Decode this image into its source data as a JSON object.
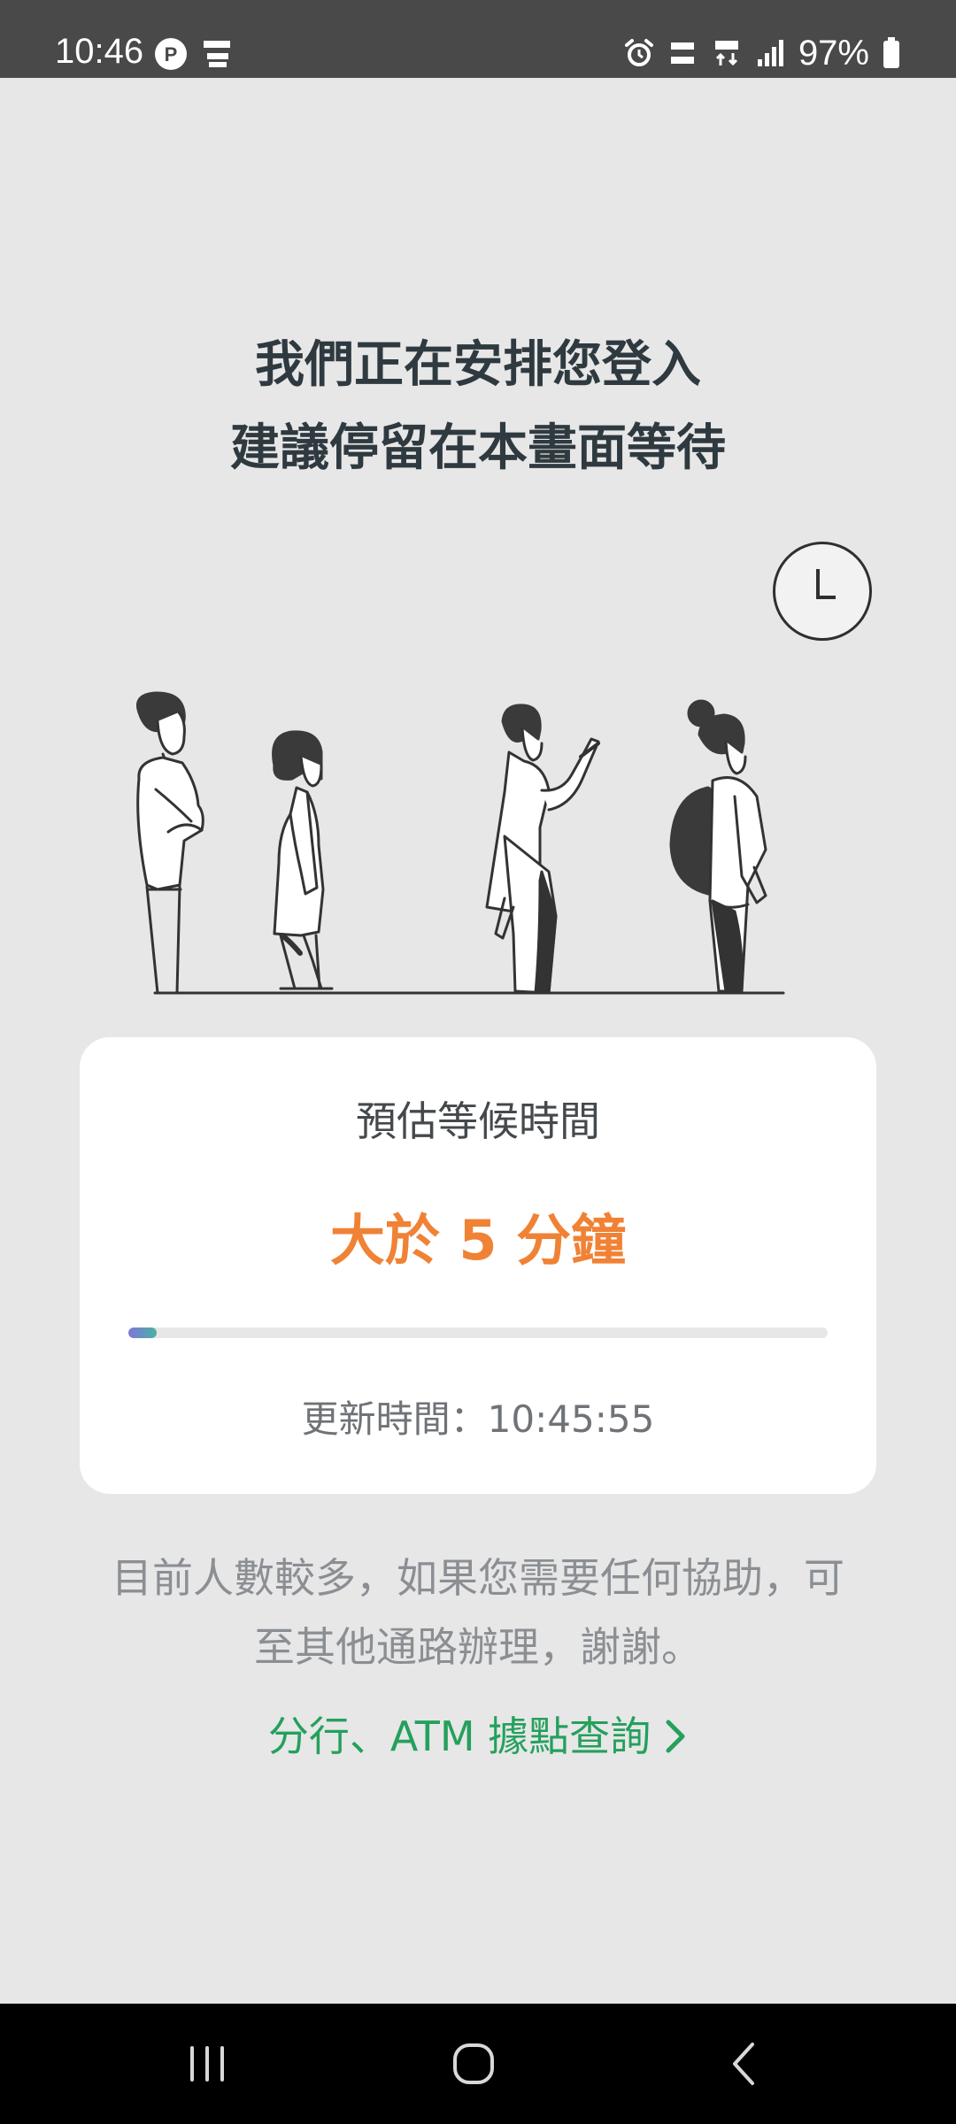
{
  "status_bar": {
    "time": "10:46",
    "battery_percent": "97%",
    "icons": [
      "p-app-icon",
      "manga-up-icon",
      "alarm-icon",
      "volte-icon",
      "4g-data-icon",
      "signal-icon",
      "battery-icon"
    ]
  },
  "title": {
    "line1": "我們正在安排您登入",
    "line2": "建議停留在本畫面等待"
  },
  "illustration": {
    "icons": [
      "clock-icon",
      "people-queue-illustration"
    ]
  },
  "wait_card": {
    "label": "預估等候時間",
    "value": "大於 5 分鐘",
    "progress": 0.04,
    "updated": "更新時間：10:45:55"
  },
  "notice": {
    "line1": "目前人數較多，如果您需要任何協助，可",
    "line2": "至其他通路辦理，謝謝。"
  },
  "link": {
    "label": "分行、ATM 據點查詢",
    "icon": "chevron-right-icon"
  },
  "nav_bar": {
    "icons": [
      "recents-icon",
      "home-icon",
      "back-icon"
    ]
  },
  "colors": {
    "accent_orange": "#f08235",
    "link_green": "#24a05d",
    "title_text": "#2f3a40",
    "background": "#e7e7e7"
  }
}
